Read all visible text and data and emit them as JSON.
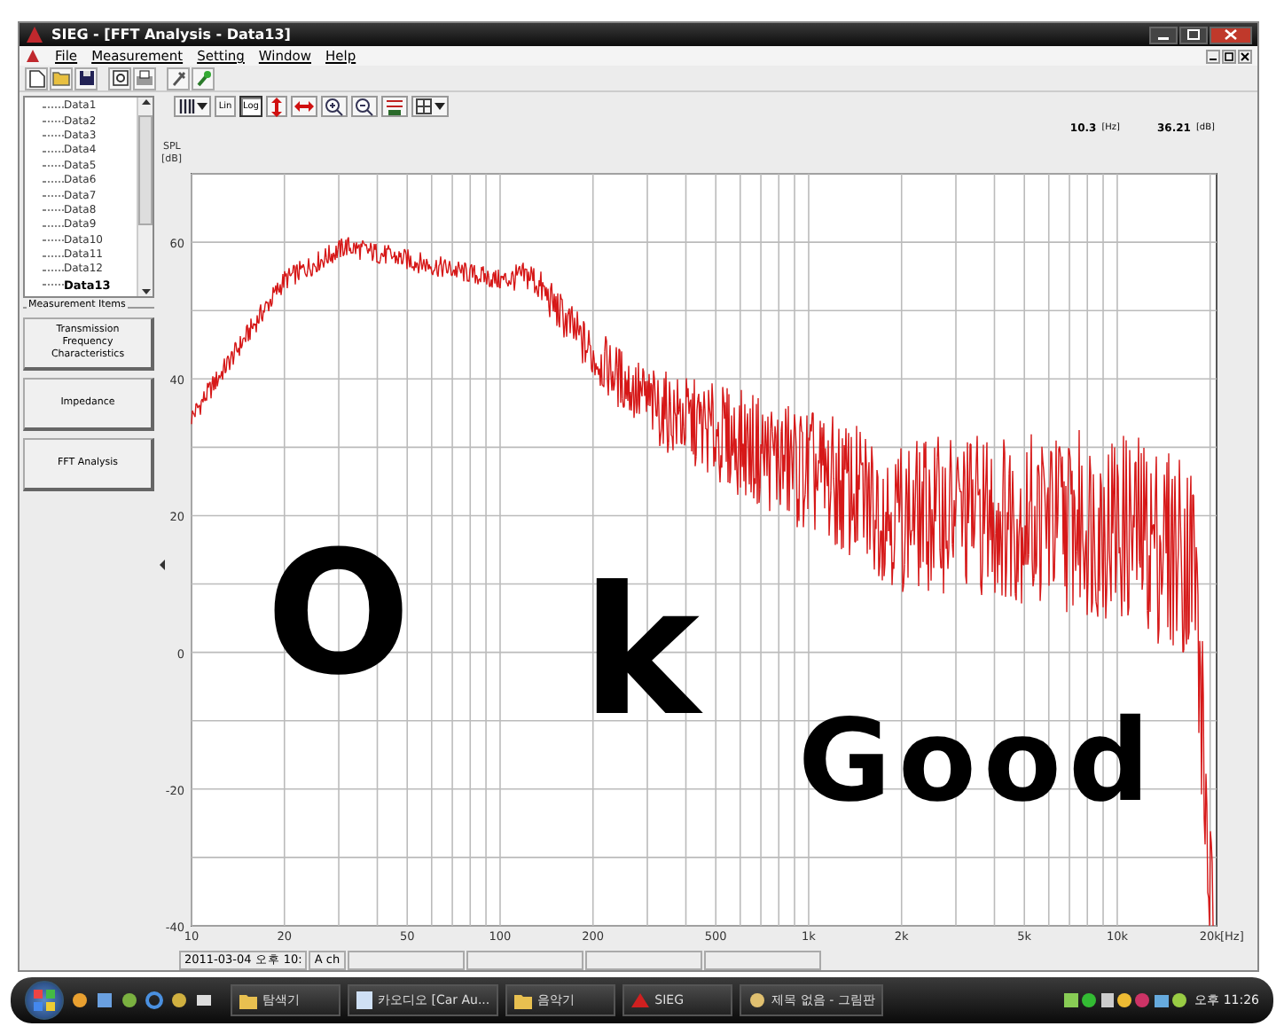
{
  "window": {
    "title": "SIEG - [FFT Analysis - Data13]"
  },
  "menu": [
    "File",
    "Measurement",
    "Setting",
    "Window",
    "Help"
  ],
  "tree": {
    "items": [
      {
        "label": "Data1",
        "selected": false
      },
      {
        "label": "Data2",
        "selected": false
      },
      {
        "label": "Data3",
        "selected": false
      },
      {
        "label": "Data4",
        "selected": false
      },
      {
        "label": "Data5",
        "selected": false
      },
      {
        "label": "Data6",
        "selected": false
      },
      {
        "label": "Data7",
        "selected": false
      },
      {
        "label": "Data8",
        "selected": false
      },
      {
        "label": "Data9",
        "selected": false
      },
      {
        "label": "Data10",
        "selected": false
      },
      {
        "label": "Data11",
        "selected": false
      },
      {
        "label": "Data12",
        "selected": false
      },
      {
        "label": "Data13",
        "selected": true
      }
    ]
  },
  "measurement_items": {
    "title": "Measurement Items",
    "buttons": [
      "Transmission Frequency Characteristics",
      "Impedance",
      "FFT Analysis"
    ]
  },
  "chart_toolbar": {
    "scale_buttons": [
      {
        "label": "Lin",
        "selected": false
      },
      {
        "label": "Log",
        "selected": true
      }
    ]
  },
  "readout": {
    "frequency": "10.3",
    "frequency_unit": "[Hz]",
    "level": "36.21",
    "level_unit": "[dB]"
  },
  "plot": {
    "y_unit": "SPL",
    "y_unit_2": "[dB]",
    "yticks": [
      "60",
      "40",
      "20",
      "0",
      "-20",
      "-40"
    ],
    "xticks": [
      "10",
      "20",
      "50",
      "100",
      "200",
      "500",
      "1k",
      "2k",
      "5k",
      "10k",
      "20k"
    ],
    "x_unit": "[Hz]"
  },
  "handwriting": [
    "O",
    "k",
    "Good"
  ],
  "status_bar": [
    "2011-03-04 오후 10:",
    "A ch"
  ],
  "taskbar": {
    "buttons": [
      {
        "label": "탐색기",
        "kind": "folder"
      },
      {
        "label": "카오디오 [Car Au...",
        "kind": "document"
      },
      {
        "label": "음악기",
        "kind": "folder"
      },
      {
        "label": "SIEG",
        "kind": "app"
      },
      {
        "label": "제목 없음 - 그림판",
        "kind": "paint"
      }
    ],
    "clock": "오후 11:26"
  }
}
